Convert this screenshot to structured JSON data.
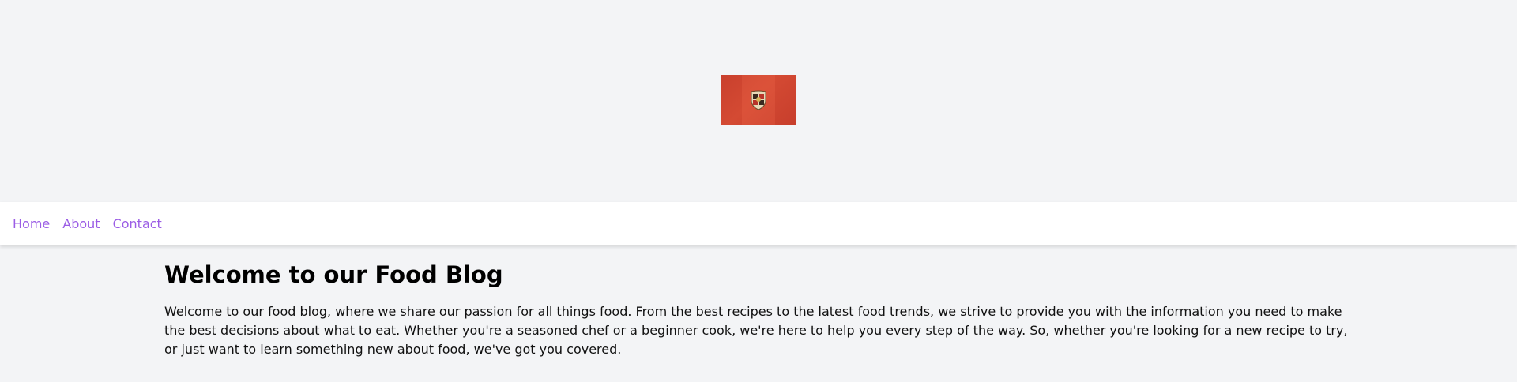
{
  "hero": {
    "logo_icon": "crest-logo-icon",
    "logo_color": "#c9402d"
  },
  "nav": {
    "items": [
      {
        "label": "Home"
      },
      {
        "label": "About"
      },
      {
        "label": "Contact"
      }
    ],
    "link_color": "#9b5de5"
  },
  "main": {
    "title": "Welcome to our Food Blog",
    "body": "Welcome to our food blog, where we share our passion for all things food. From the best recipes to the latest food trends, we strive to provide you with the information you need to make the best decisions about what to eat. Whether you're a seasoned chef or a beginner cook, we're here to help you every step of the way. So, whether you're looking for a new recipe to try, or just want to learn something new about food, we've got you covered."
  }
}
